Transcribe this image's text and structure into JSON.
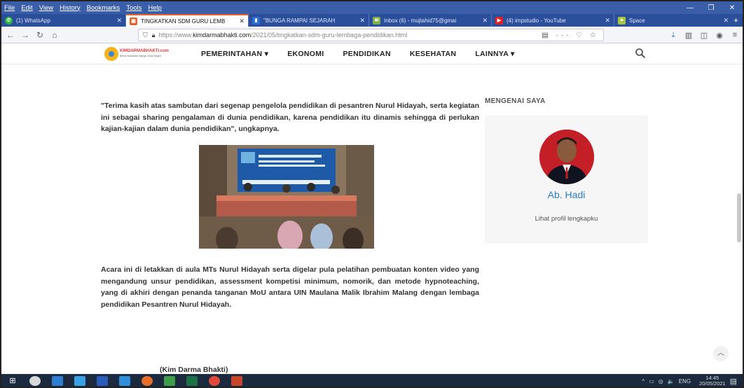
{
  "browser": {
    "menu": [
      "File",
      "Edit",
      "View",
      "History",
      "Bookmarks",
      "Tools",
      "Help"
    ],
    "tabs": [
      {
        "label": "(1) WhatsApp",
        "color": "#2bb741",
        "glyph": "✆"
      },
      {
        "label": "TINGKATKAN SDM GURU LEMB",
        "color": "#e8622c",
        "glyph": "▣",
        "active": true
      },
      {
        "label": "\"BUNGA RAMPAI SEJARAH",
        "color": "#2b6fd6",
        "glyph": "▮"
      },
      {
        "label": "Inbox (6) - mujtahid75@gmai",
        "color": "#7fb045",
        "glyph": "✉"
      },
      {
        "label": "(4) impstudio - YouTube",
        "color": "#e02020",
        "glyph": "▶"
      },
      {
        "label": "Space",
        "color": "#a7c441",
        "glyph": "✦"
      }
    ],
    "url_prefix": "https://www.",
    "url_domain": "kimdarmabhakti.com",
    "url_path": "/2021/05/tingkatkan-sdm-guru-lembaga-pendidikan.html",
    "url_icons": "▤ ··· ♡ ☆"
  },
  "site": {
    "logo_text": "KIMDARMABHAKTI.com",
    "logo_tagline": "Berita Nusantara Warga Untuk Negeri",
    "nav": [
      "PEMERINTAHAN ▾",
      "EKONOMI",
      "PENDIDIKAN",
      "KESEHATAN",
      "LAINNYA ▾"
    ]
  },
  "article": {
    "p1": "\"Terima kasih atas sambutan dari segenap pengelola pendidikan di pesantren Nurul Hidayah, serta kegiatan ini sebagai sharing pengalaman di dunia pendidikan, karena pendidikan itu dinamis sehingga di perlukan kajian-kajian dalam dunia pendidikan\", ungkapnya.",
    "p2": "Acara ini di letakkan di aula MTs Nurul Hidayah serta digelar pula pelatihan pembuatan konten video yang mengandung unsur pendidikan, assessment kompetisi minimum, nomorik, dan metode hypnoteaching, yang di akhiri dengan penanda tanganan MoU antara UIN Maulana Malik Ibrahim Malang dengan lembaga pendidikan Pesantren Nurul Hidayah.",
    "caption": "(Kim Darma Bhakti)"
  },
  "sidebar": {
    "title": "MENGENAI SAYA",
    "name": "Ab. Hadi",
    "profile_link": "Lihat profil lengkapku"
  },
  "taskbar": {
    "tray": [
      "^",
      "▭",
      "◎",
      "🔈",
      "ENG"
    ],
    "time": "14:45",
    "date": "20/05/2021"
  }
}
